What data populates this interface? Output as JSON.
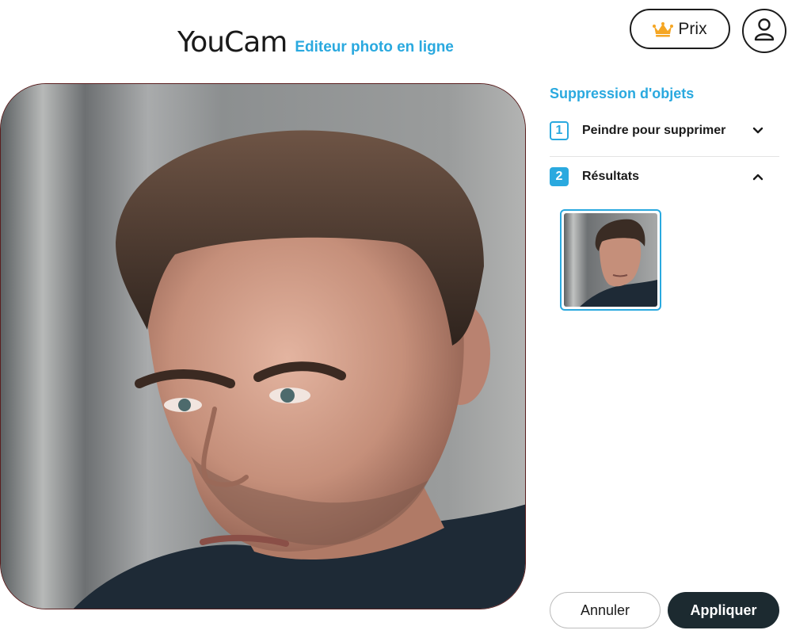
{
  "header": {
    "brand": "YouCam",
    "subtitle": "Editeur photo en ligne",
    "price_label": "Prix",
    "crown_icon": "crown-icon",
    "account_icon": "user-icon"
  },
  "canvas": {
    "image_description_icon": "portrait-photo"
  },
  "panel": {
    "title": "Suppression d'objets",
    "steps": [
      {
        "number": "1",
        "label": "Peindre pour supprimer",
        "state": "collapsed"
      },
      {
        "number": "2",
        "label": "Résultats",
        "state": "expanded"
      }
    ]
  },
  "footer": {
    "cancel_label": "Annuler",
    "apply_label": "Appliquer"
  },
  "colors": {
    "accent": "#2aa9df",
    "dark_button": "#1c2a30",
    "crown": "#f5a623"
  }
}
